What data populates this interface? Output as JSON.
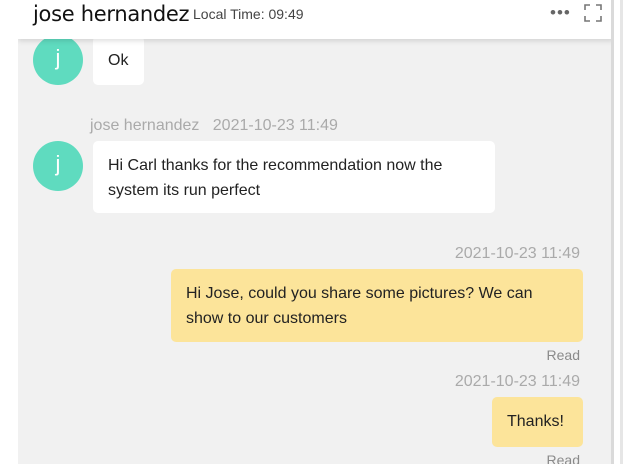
{
  "header": {
    "contact_name": "jose hernandez",
    "local_time": "Local Time: 09:49",
    "more_icon": "more-horizontal-icon",
    "expand_icon": "expand-icon"
  },
  "messages": [
    {
      "direction": "incoming",
      "avatar_letter": "j",
      "text": "Ok"
    },
    {
      "direction": "incoming",
      "sender": "jose hernandez",
      "time": "2021-10-23 11:49",
      "avatar_letter": "j",
      "text_lines": [
        "Hi Carl thanks for the recommendation now the",
        "system its run perfect"
      ]
    },
    {
      "direction": "outgoing",
      "time": "2021-10-23 11:49",
      "text_lines": [
        "Hi Jose, could you share some pictures? We can",
        "show to our customers"
      ],
      "status": "Read"
    },
    {
      "direction": "outgoing",
      "time": "2021-10-23 11:49",
      "text": "Thanks!",
      "status": "Read"
    }
  ],
  "colors": {
    "avatar": "#5fdbbf",
    "outgoing_bubble": "#fce49a",
    "incoming_bubble": "#ffffff",
    "chat_background": "#f1f1f1"
  }
}
